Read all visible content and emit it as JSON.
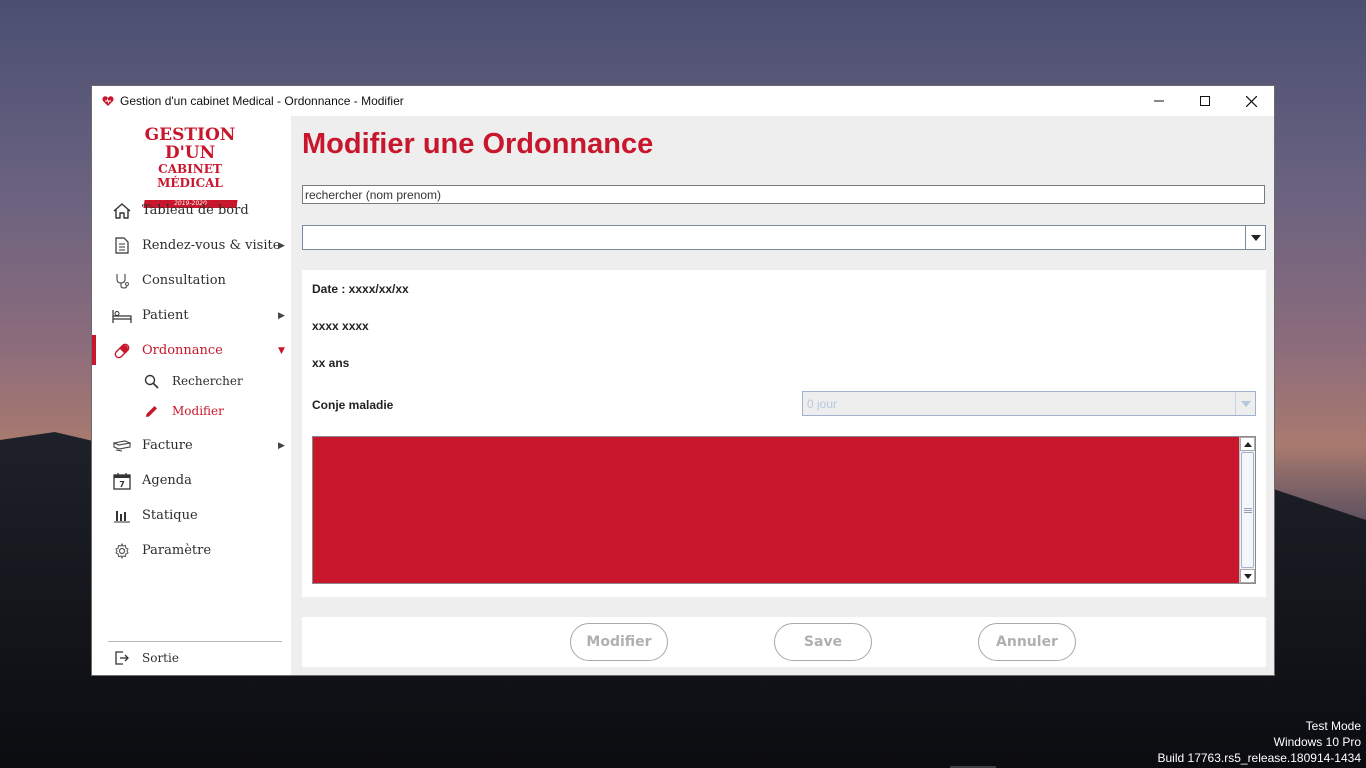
{
  "window": {
    "title": "Gestion d'un cabinet Medical - Ordonnance - Modifier"
  },
  "logo": {
    "line1": "GESTION D'UN",
    "line2": "CABINET MÉDICAL",
    "line3": "2019-2020"
  },
  "sidebar": {
    "items": [
      {
        "label": "Tableau de bord",
        "icon": "home-icon"
      },
      {
        "label": "Rendez-vous & visite",
        "icon": "document-icon",
        "arrow": "▶"
      },
      {
        "label": "Consultation",
        "icon": "stethoscope-icon"
      },
      {
        "label": "Patient",
        "icon": "bed-icon",
        "arrow": "▶"
      },
      {
        "label": "Ordonnance",
        "icon": "pill-icon",
        "arrow": "▼"
      },
      {
        "label": "Facture",
        "icon": "money-icon",
        "arrow": "▶"
      },
      {
        "label": "Agenda",
        "icon": "calendar-icon",
        "calendar_day": "7"
      },
      {
        "label": "Statique",
        "icon": "bar-chart-icon"
      },
      {
        "label": "Paramètre",
        "icon": "gear-icon"
      }
    ],
    "sub_items": [
      {
        "label": "Rechercher",
        "icon": "search-icon"
      },
      {
        "label": "Modifier",
        "icon": "pencil-icon"
      }
    ],
    "exit_label": "Sortie"
  },
  "main": {
    "title": "Modifier une Ordonnance",
    "search_value": "rechercher (nom prenom)",
    "select_value": "",
    "date_text": "Date : xxxx/xx/xx",
    "name_text": "xxxx xxxx",
    "age_text": "xx ans",
    "conje_label": "Conje maladie",
    "conje_value": "0   jour",
    "buttons": {
      "modifier": "Modifier",
      "save": "Save",
      "annuler": "Annuler"
    }
  },
  "desktop": {
    "watermark_line1": "Test Mode",
    "watermark_line2": "Windows 10 Pro",
    "watermark_line3": "Build 17763.rs5_release.180914-1434"
  },
  "colors": {
    "accent": "#c8172d",
    "panel_bg": "#eeeeee",
    "disabled_text": "#b0b0b0"
  }
}
